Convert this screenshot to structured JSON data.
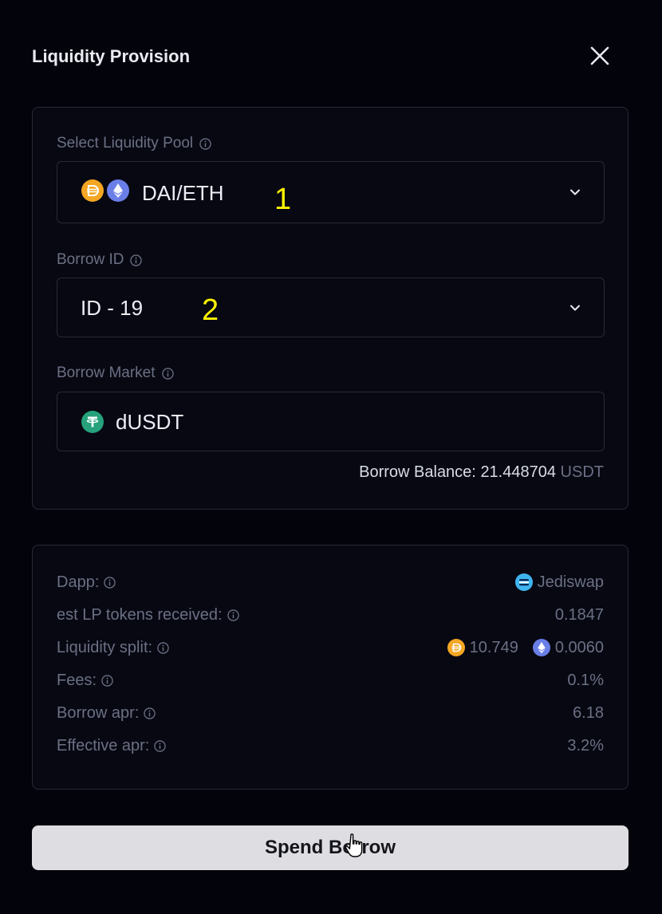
{
  "modal": {
    "title": "Liquidity Provision"
  },
  "pool_select": {
    "label": "Select Liquidity Pool",
    "value": "DAI/ETH",
    "icons": [
      "dai-icon",
      "eth-icon"
    ]
  },
  "borrow_id": {
    "label": "Borrow ID",
    "value": "ID - 19"
  },
  "borrow_market": {
    "label": "Borrow Market",
    "value": "dUSDT",
    "icon": "usdt-icon"
  },
  "borrow_balance": {
    "label": "Borrow Balance:",
    "amount": "21.448704",
    "unit": "USDT"
  },
  "details": {
    "dapp": {
      "label": "Dapp:",
      "value": "Jediswap",
      "icon": "jediswap-icon"
    },
    "lp_tokens": {
      "label": "est LP tokens received:",
      "value": "0.1847"
    },
    "liquidity_split": {
      "label": "Liquidity split:",
      "dai_value": "10.749",
      "eth_value": "0.0060"
    },
    "fees": {
      "label": "Fees:",
      "value": "0.1%"
    },
    "borrow_apr": {
      "label": "Borrow apr:",
      "value": "6.18"
    },
    "effective_apr": {
      "label": "Effective apr:",
      "value": "3.2%"
    }
  },
  "annotations": {
    "one": "1",
    "two": "2"
  },
  "action": {
    "label": "Spend Borrow"
  },
  "colors": {
    "background": "#02030b",
    "panel_border": "#262a38",
    "muted_text": "#6b7084",
    "button_bg": "#dedee2",
    "annotation": "#fff200",
    "dai": "#f5a623",
    "eth": "#6a7ee8",
    "usdt": "#26a17b"
  }
}
